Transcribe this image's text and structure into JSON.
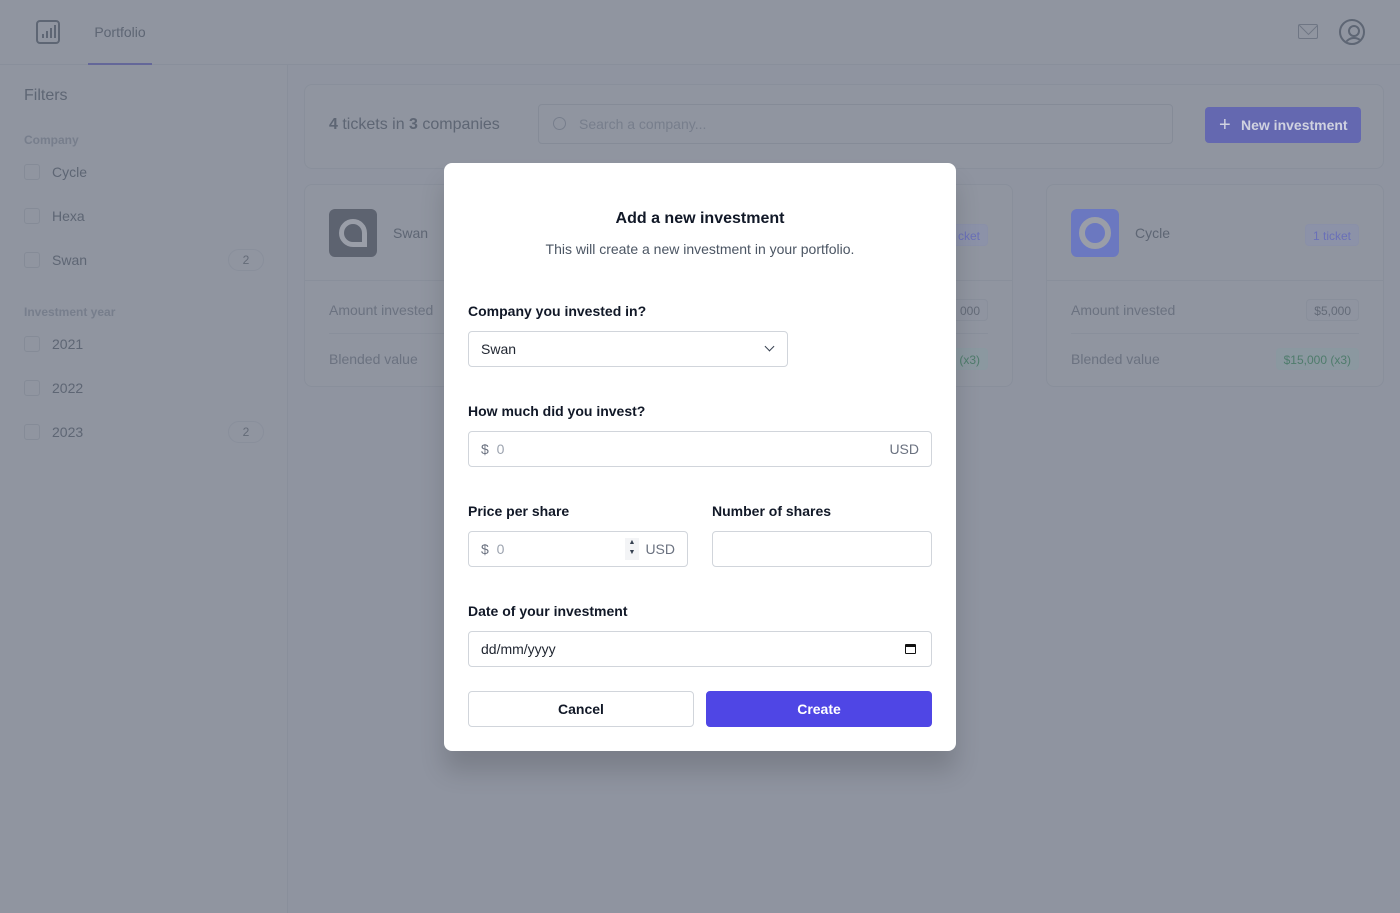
{
  "header": {
    "tab": "Portfolio",
    "logo_icon": "bar-chart-icon",
    "mail_icon": "mail-icon",
    "user_icon": "user-circle-icon"
  },
  "sidebar": {
    "title": "Filters",
    "company_label": "Company",
    "companies": [
      {
        "label": "Cycle",
        "count": null
      },
      {
        "label": "Hexa",
        "count": null
      },
      {
        "label": "Swan",
        "count": "2"
      }
    ],
    "year_label": "Investment year",
    "years": [
      {
        "label": "2021",
        "count": null
      },
      {
        "label": "2022",
        "count": null
      },
      {
        "label": "2023",
        "count": "2"
      }
    ]
  },
  "summary": {
    "tickets": "4",
    "t1": " tickets in ",
    "companies": "3",
    "t2": " companies",
    "search_placeholder": "Search a company...",
    "new_button": "New investment"
  },
  "cards": [
    {
      "name": "Swan",
      "amount_label": "Amount invested",
      "blended_label": "Blended value"
    },
    {
      "badge": "cket",
      "amount": "000",
      "blended": "(x3)"
    },
    {
      "name": "Cycle",
      "badge": "1 ticket",
      "amount_label": "Amount invested",
      "amount": "$5,000",
      "blended_label": "Blended value",
      "blended": "$15,000 (x3)"
    }
  ],
  "modal": {
    "title": "Add a new investment",
    "subtitle": "This will create a new investment in your portfolio.",
    "company_label": "Company you invested in?",
    "company_value": "Swan",
    "amount_label": "How much did you invest?",
    "currency_symbol": "$",
    "amount_placeholder": "0",
    "amount_currency": "USD",
    "price_label": "Price per share",
    "price_placeholder": "0",
    "price_currency": "USD",
    "shares_label": "Number of shares",
    "shares_value": "",
    "date_label": "Date of your investment",
    "date_placeholder": "dd/mm/yyyy",
    "cancel": "Cancel",
    "create": "Create"
  },
  "colors": {
    "accent": "#4f46e5",
    "overlay": "rgba(107,114,128,0.75)"
  }
}
